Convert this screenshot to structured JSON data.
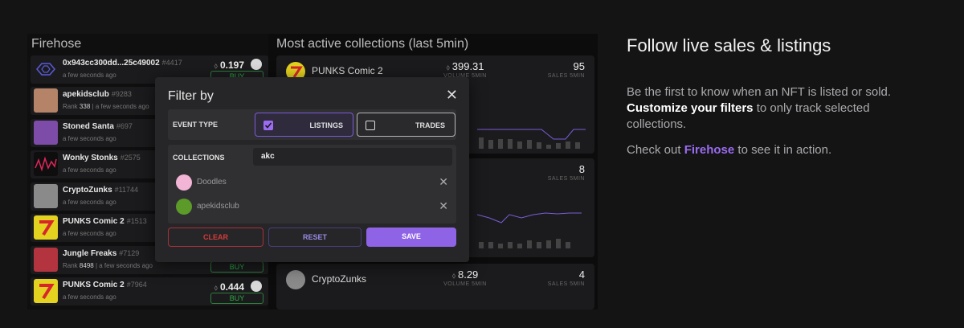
{
  "firehose": {
    "title": "Firehose",
    "rows": [
      {
        "name": "0x943cc300dd...25c49002",
        "token": "#4417",
        "sub_pre": "",
        "rank": "",
        "sub": "a few seconds ago",
        "price": "0.197",
        "buy": "BUY"
      },
      {
        "name": "apekidsclub",
        "token": "#9283",
        "sub_pre": "Rank",
        "rank": "338",
        "sub": "| a few seconds ago",
        "price": "",
        "buy": ""
      },
      {
        "name": "Stoned Santa",
        "token": "#697",
        "sub_pre": "",
        "rank": "",
        "sub": "a few seconds ago",
        "price": "",
        "buy": ""
      },
      {
        "name": "Wonky Stonks",
        "token": "#2575",
        "sub_pre": "",
        "rank": "",
        "sub": "a few seconds ago",
        "price": "",
        "buy": ""
      },
      {
        "name": "CryptoZunks",
        "token": "#11744",
        "sub_pre": "",
        "rank": "",
        "sub": "a few seconds ago",
        "price": "",
        "buy": ""
      },
      {
        "name": "PUNKS Comic 2",
        "token": "#1513",
        "sub_pre": "",
        "rank": "",
        "sub": "a few seconds ago",
        "price": "",
        "buy": ""
      },
      {
        "name": "Jungle Freaks",
        "token": "#7129",
        "sub_pre": "Rank",
        "rank": "8498",
        "sub": "| a few seconds ago",
        "price": "",
        "buy": "BUY"
      },
      {
        "name": "PUNKS Comic 2",
        "token": "#7964",
        "sub_pre": "",
        "rank": "",
        "sub": "a few seconds ago",
        "price": "0.444",
        "buy": "BUY"
      }
    ]
  },
  "collections": {
    "title": "Most active collections (last 5min)",
    "cards": [
      {
        "name": "PUNKS Comic 2",
        "volume": "399.31",
        "volume_label": "VOLUME 5MIN",
        "sales": "95",
        "sales_label": "SALES 5MIN"
      },
      {
        "name": "",
        "volume": "",
        "volume_label": "",
        "sales": "8",
        "sales_label": "SALES 5MIN"
      },
      {
        "name": "CryptoZunks",
        "volume": "8.29",
        "volume_label": "VOLUME 5MIN",
        "sales": "4",
        "sales_label": "SALES 5MIN"
      }
    ]
  },
  "modal": {
    "title": "Filter by",
    "event_type_label": "EVENT TYPE",
    "listings_label": "LISTINGS",
    "listings_checked": true,
    "trades_label": "TRADES",
    "trades_checked": false,
    "collections_label": "COLLECTIONS",
    "search_value": "akc",
    "selected": [
      {
        "name": "Doodles"
      },
      {
        "name": "apekidsclub"
      }
    ],
    "clear_label": "CLEAR",
    "reset_label": "RESET",
    "save_label": "SAVE"
  },
  "marketing": {
    "heading": "Follow live sales & listings",
    "para1_a": "Be the first to know when an NFT is listed or sold. ",
    "para1_bold": "Customize your filters",
    "para1_b": " to only track selected collections.",
    "para2_a": "Check out ",
    "para2_link": "Firehose",
    "para2_b": " to see it in action."
  },
  "colors": {
    "accent_purple": "#9b6cf2",
    "buy_green": "#2fae46",
    "clear_red": "#d83a3a"
  }
}
